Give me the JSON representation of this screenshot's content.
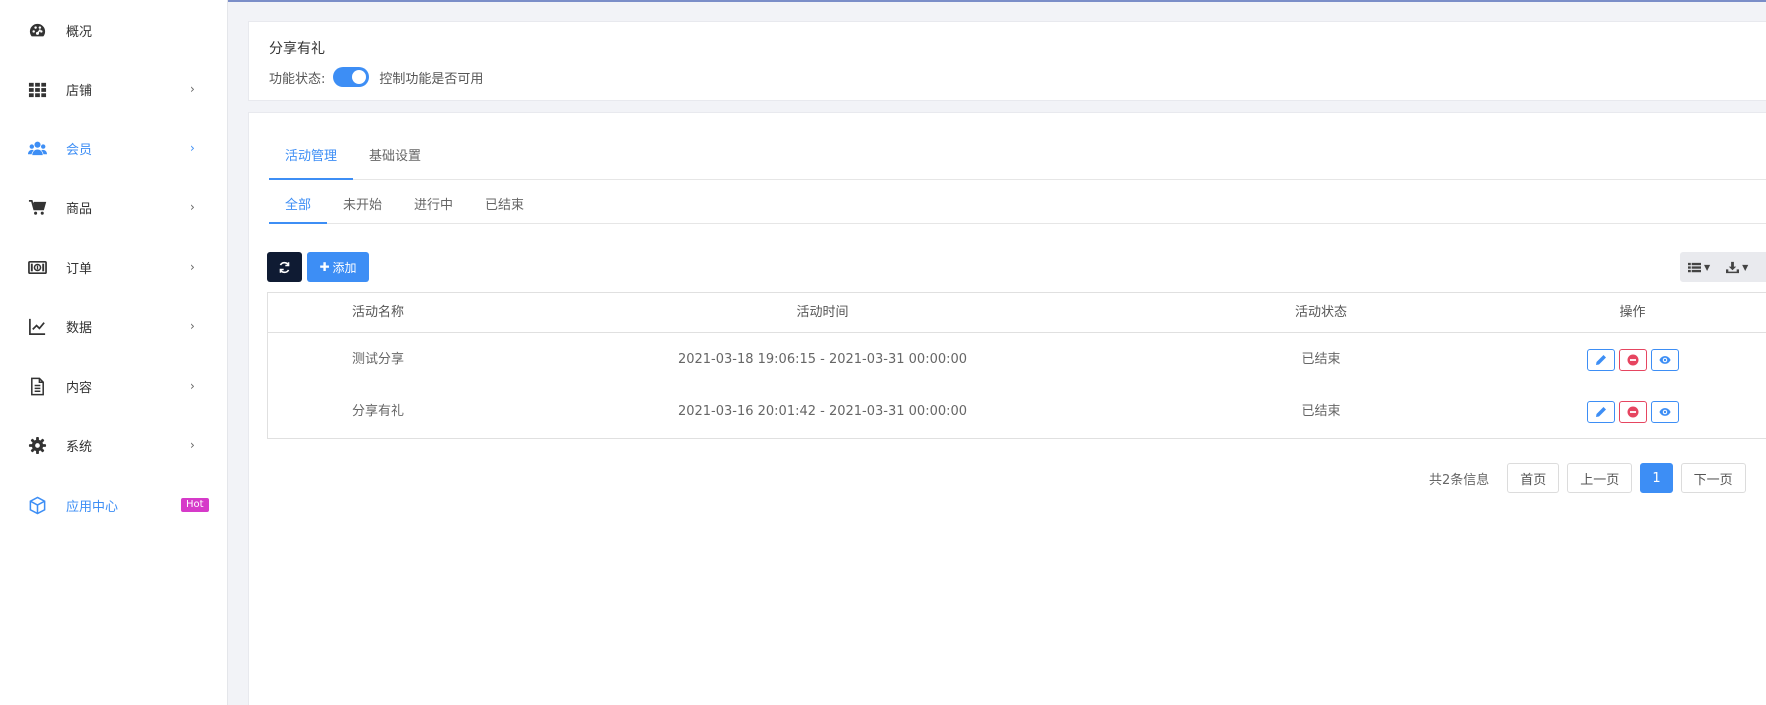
{
  "colors": {
    "accent": "#3d8ef5",
    "dark_button": "#0f1b33",
    "danger": "#e64560",
    "hot_badge": "#d63ac9"
  },
  "sidebar": {
    "items": [
      {
        "label": "概况",
        "icon": "dashboard-icon"
      },
      {
        "label": "店铺",
        "icon": "grid-icon",
        "chevron": "›"
      },
      {
        "label": "会员",
        "icon": "users-icon",
        "chevron": "›"
      },
      {
        "label": "商品",
        "icon": "cart-icon",
        "chevron": "›"
      },
      {
        "label": "订单",
        "icon": "money-icon",
        "chevron": "›"
      },
      {
        "label": "数据",
        "icon": "line-chart-icon",
        "chevron": "›"
      },
      {
        "label": "内容",
        "icon": "document-icon",
        "chevron": "›"
      },
      {
        "label": "系统",
        "icon": "gear-icon",
        "chevron": "›"
      },
      {
        "label": "应用中心",
        "icon": "cube-icon",
        "badge": "Hot"
      }
    ]
  },
  "feature": {
    "title": "分享有礼",
    "status_label": "功能状态:",
    "status_hint": "控制功能是否可用"
  },
  "tabs": [
    "活动管理",
    "基础设置"
  ],
  "subtabs": [
    "全部",
    "未开始",
    "进行中",
    "已结束"
  ],
  "toolbar": {
    "add_label": "添加"
  },
  "table": {
    "headers": [
      "活动名称",
      "活动时间",
      "活动状态",
      "操作"
    ],
    "rows": [
      {
        "name": "测试分享",
        "time": "2021-03-18 19:06:15 - 2021-03-31 00:00:00",
        "status": "已结束"
      },
      {
        "name": "分享有礼",
        "time": "2021-03-16 20:01:42 - 2021-03-31 00:00:00",
        "status": "已结束"
      }
    ]
  },
  "pagination": {
    "total": "共2条信息",
    "first": "首页",
    "prev": "上一页",
    "current": "1",
    "next": "下一页"
  }
}
